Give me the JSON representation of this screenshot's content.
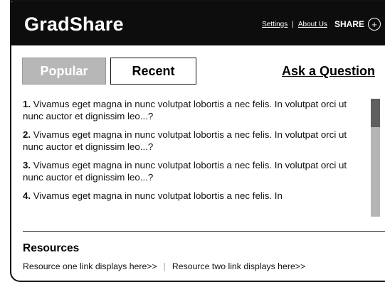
{
  "header": {
    "brand": "GradShare",
    "settings_label": "Settings",
    "separator": "|",
    "about_label": "About Us",
    "share_label": "SHARE",
    "share_icon": "plus-circle-icon",
    "background_color": "#0d0d0d"
  },
  "tabs": [
    {
      "label": "Popular",
      "active": true
    },
    {
      "label": "Recent",
      "active": false
    }
  ],
  "ask_label": "Ask a Question",
  "questions": [
    {
      "num": "1.",
      "text": " Vivamus eget magna in nunc volutpat lobortis a nec felis. In volutpat orci ut nunc auctor et dignissim leo...?"
    },
    {
      "num": "2.",
      "text": " Vivamus eget magna in nunc volutpat lobortis a nec felis. In volutpat orci ut nunc auctor et dignissim leo...?"
    },
    {
      "num": "3.",
      "text": " Vivamus eget magna in nunc volutpat lobortis a nec felis. In volutpat orci ut nunc auctor et dignissim leo...?"
    },
    {
      "num": "4.",
      "text": " Vivamus eget magna in nunc volutpat lobortis a nec felis. In"
    }
  ],
  "resources": {
    "title": "Resources",
    "link_one": "Resource one link displays here>>",
    "divider": "|",
    "link_two": "Resource two link displays here>>"
  }
}
